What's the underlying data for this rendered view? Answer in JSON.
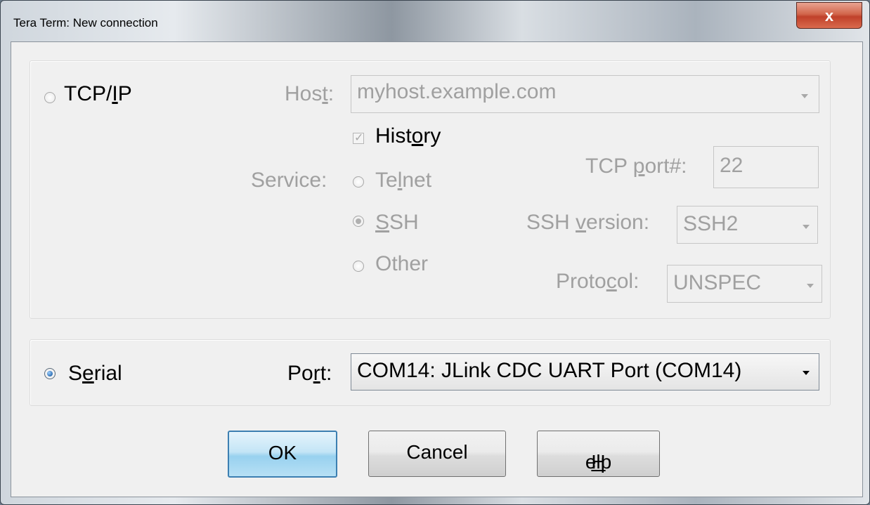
{
  "window": {
    "title": "Tera Term: New connection",
    "close_glyph": "x"
  },
  "tcpip": {
    "radio_label_pre": "TCP/",
    "radio_label_u": "I",
    "radio_label_post": "P",
    "host_label_pre": "Hos",
    "host_label_u": "t",
    "host_label_post": ":",
    "host_value": "myhost.example.com",
    "history_pre": "Hist",
    "history_u": "o",
    "history_post": "ry",
    "history_checked": true,
    "service_label": "Service:",
    "telnet_pre": "Te",
    "telnet_u": "l",
    "telnet_post": "net",
    "ssh_u": "S",
    "ssh_post": "SH",
    "other_label": "Other",
    "tcp_port_pre": "TCP ",
    "tcp_port_u": "p",
    "tcp_port_post": "ort#:",
    "tcp_port_value": "22",
    "ssh_version_pre": "SSH ",
    "ssh_version_u": "v",
    "ssh_version_post": "ersion:",
    "ssh_version_value": "SSH2",
    "protocol_pre": "Proto",
    "protocol_u": "c",
    "protocol_post": "ol:",
    "protocol_value": "UNSPEC"
  },
  "serial": {
    "radio_label_pre": "S",
    "radio_label_u": "e",
    "radio_label_post": "rial",
    "port_label_pre": "Po",
    "port_label_u": "r",
    "port_label_post": "t:",
    "port_value": "COM14: JLink CDC UART Port (COM14)"
  },
  "buttons": {
    "ok": "OK",
    "cancel": "Cancel",
    "help_u": "H",
    "help_post": "elp"
  }
}
